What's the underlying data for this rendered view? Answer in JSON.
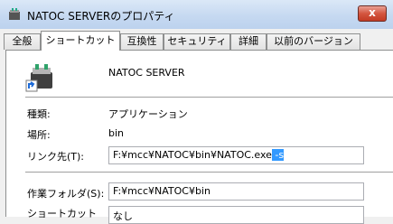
{
  "window": {
    "title": "NATOC SERVERのプロパティ",
    "close": "x"
  },
  "tabs": [
    {
      "label": "全般"
    },
    {
      "label": "ショートカット"
    },
    {
      "label": "互換性"
    },
    {
      "label": "セキュリティ"
    },
    {
      "label": "詳細"
    },
    {
      "label": "以前のバージョン"
    }
  ],
  "header": {
    "name": "NATOC SERVER"
  },
  "type": {
    "label": "種類:",
    "value": "アプリケーション"
  },
  "location": {
    "label": "場所:",
    "value": "bin"
  },
  "target": {
    "label": "リンク先(T):",
    "value_main": "F:¥mcc¥NATOC¥bin¥NATOC.exe",
    "value_selected": " -s"
  },
  "start_in": {
    "label": "作業フォルダ(S):",
    "value": "F:¥mcc¥NATOC¥bin"
  },
  "shortcut_key": {
    "label": "ショートカット",
    "value": "なし"
  },
  "colors": {
    "accent": "#3399ff",
    "close": "#c23b24"
  }
}
